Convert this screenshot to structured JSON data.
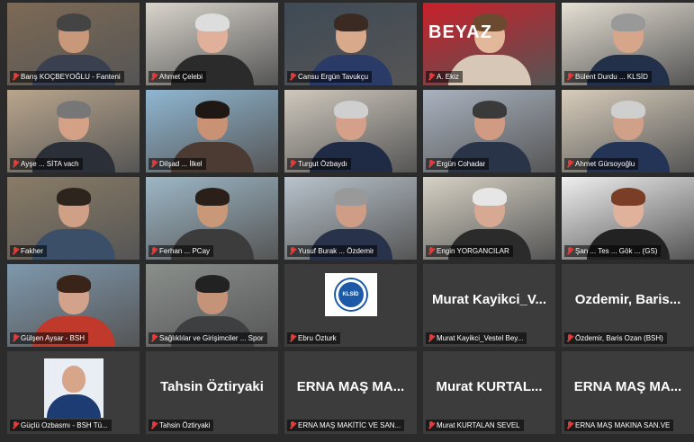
{
  "participants": [
    {
      "name": "Barış KOÇBEYOĞLU - Fanteni",
      "style": {
        "bg": "#7d6a55",
        "skin": "#c9977a",
        "hair": "#444",
        "shirt": "#3a4050"
      }
    },
    {
      "name": "Ahmet Çelebi",
      "style": {
        "bg": "#d9d4cc",
        "skin": "#e0b09a",
        "hair": "#ddd",
        "shirt": "#2b2b2b"
      }
    },
    {
      "name": "Cansu Ergün Tavukçu",
      "style": {
        "bg": "#3f4a55",
        "skin": "#d8a98a",
        "hair": "#3b2a22",
        "shirt": "#2a3b68"
      }
    },
    {
      "name": "A. Ekiz",
      "style": {
        "bg": "#c8202a",
        "skin": "#e2b79a",
        "hair": "#6b4a2f",
        "shirt": "#d6c7b6"
      },
      "banner": "BEYAZ"
    },
    {
      "name": "Bülent Durdu ... KLSİD",
      "style": {
        "bg": "#e6e0d4",
        "skin": "#d6a58a",
        "hair": "#999",
        "shirt": "#22304a"
      }
    },
    {
      "name": "Ayşe ... SİTA vach",
      "style": {
        "bg": "#b9a58c",
        "skin": "#d4a186",
        "hair": "#777",
        "shirt": "#2b2f38"
      }
    },
    {
      "name": "Dilşad ... İlkel",
      "style": {
        "bg": "#8fb7d2",
        "skin": "#c99275",
        "hair": "#1f1713",
        "shirt": "#4c3b33"
      }
    },
    {
      "name": "Turgut Özbaydı",
      "style": {
        "bg": "#cfc8bd",
        "skin": "#d4a08a",
        "hair": "#cfcfcf",
        "shirt": "#1f2a44"
      }
    },
    {
      "name": "Ergün Cohadar",
      "style": {
        "bg": "#a9b2bf",
        "skin": "#d09b82",
        "hair": "#3a3a3a",
        "shirt": "#2a3448"
      }
    },
    {
      "name": "Ahmet Gürsoyoğlu",
      "style": {
        "bg": "#d8cdbb",
        "skin": "#d1a089",
        "hair": "#cfcfcf",
        "shirt": "#233457"
      }
    },
    {
      "name": "Fakher",
      "style": {
        "bg": "#8a7c66",
        "skin": "#cf9f86",
        "hair": "#2d241d",
        "shirt": "#3b5068"
      }
    },
    {
      "name": "Ferhan ... PCay",
      "style": {
        "bg": "#9db7c6",
        "skin": "#c99878",
        "hair": "#2a2019",
        "shirt": "#3c3c3c"
      }
    },
    {
      "name": "Yusuf Burak ... Özdemir",
      "style": {
        "bg": "#b8c3cc",
        "skin": "#cf9c85",
        "hair": "#999",
        "shirt": "#28324a"
      }
    },
    {
      "name": "Engin YORGANCILAR",
      "style": {
        "bg": "#d6d1c4",
        "skin": "#d7a992",
        "hair": "#e6e6e6",
        "shirt": "#2b2b2b"
      },
      "active": true
    },
    {
      "name": "Şan ... Tes ... Gök ... (GS)",
      "style": {
        "bg": "#efefef",
        "skin": "#e0b29b",
        "hair": "#7a3e26",
        "shirt": "#222"
      }
    },
    {
      "name": "Gülşen Aysar - BSH",
      "style": {
        "bg": "#7e98ad",
        "skin": "#d3a28a",
        "hair": "#3a2318",
        "shirt": "#c0392b"
      }
    },
    {
      "name": "Sağlıklılar ve Girişimciler ... Spor",
      "style": {
        "bg": "#8a8f8c",
        "skin": "#c49378",
        "hair": "#222",
        "shirt": "#3d3f41"
      }
    },
    {
      "name": "Ebru Özturk",
      "logo": true
    },
    {
      "name": "Murat Kayikci_Vestel Bey...",
      "big": "Murat Kayikci_V..."
    },
    {
      "name": "Özdemir, Baris Ozan (BSH)",
      "big": "Ozdemir,  Baris..."
    },
    {
      "name": "Güçlü Ozbasmı - BSH Tü...",
      "photo": true
    },
    {
      "name": "Tahsin Öztiryaki",
      "big": "Tahsin Öztiryaki"
    },
    {
      "name": "ERNA MAŞ MAKİTİC VE SAN...",
      "big": "ERNA MAŞ MA..."
    },
    {
      "name": "Murat KURTALAN SEVEL",
      "big": "Murat  KURTAL..."
    },
    {
      "name": "ERNA MAŞ MAKINA SAN.VE",
      "big": "ERNA MAŞ MA..."
    }
  ],
  "logo_text": "KLSİD",
  "colors": {
    "background": "#2b2b2b",
    "tile": "#3c3c3c",
    "active_border": "#c9d93a",
    "muted_icon": "#e23b3b"
  },
  "icons": {
    "mic": "mic-muted-icon"
  }
}
